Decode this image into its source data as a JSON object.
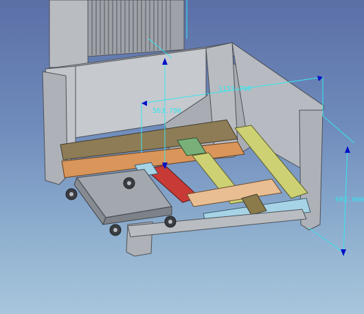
{
  "viewport": {
    "background_top": "#5b6fa6",
    "background_bottom": "#a8c6dc"
  },
  "dimensions": {
    "width": "1157.790",
    "depth": "563.790",
    "height": "692.000",
    "color": "#35e6f0"
  },
  "colors": {
    "steel_light": "#c9ccd0",
    "steel_mid": "#aeb2b8",
    "steel_dark": "#7d8289",
    "beam_brown": "#8e7c56",
    "beam_orange": "#d9955a",
    "beam_green": "#79b07a",
    "beam_yellow": "#cdd173",
    "beam_red": "#c83a36",
    "beam_skyblue": "#a7d3e6",
    "beam_peach": "#e9be92",
    "beam_olive": "#8b7a4a"
  }
}
